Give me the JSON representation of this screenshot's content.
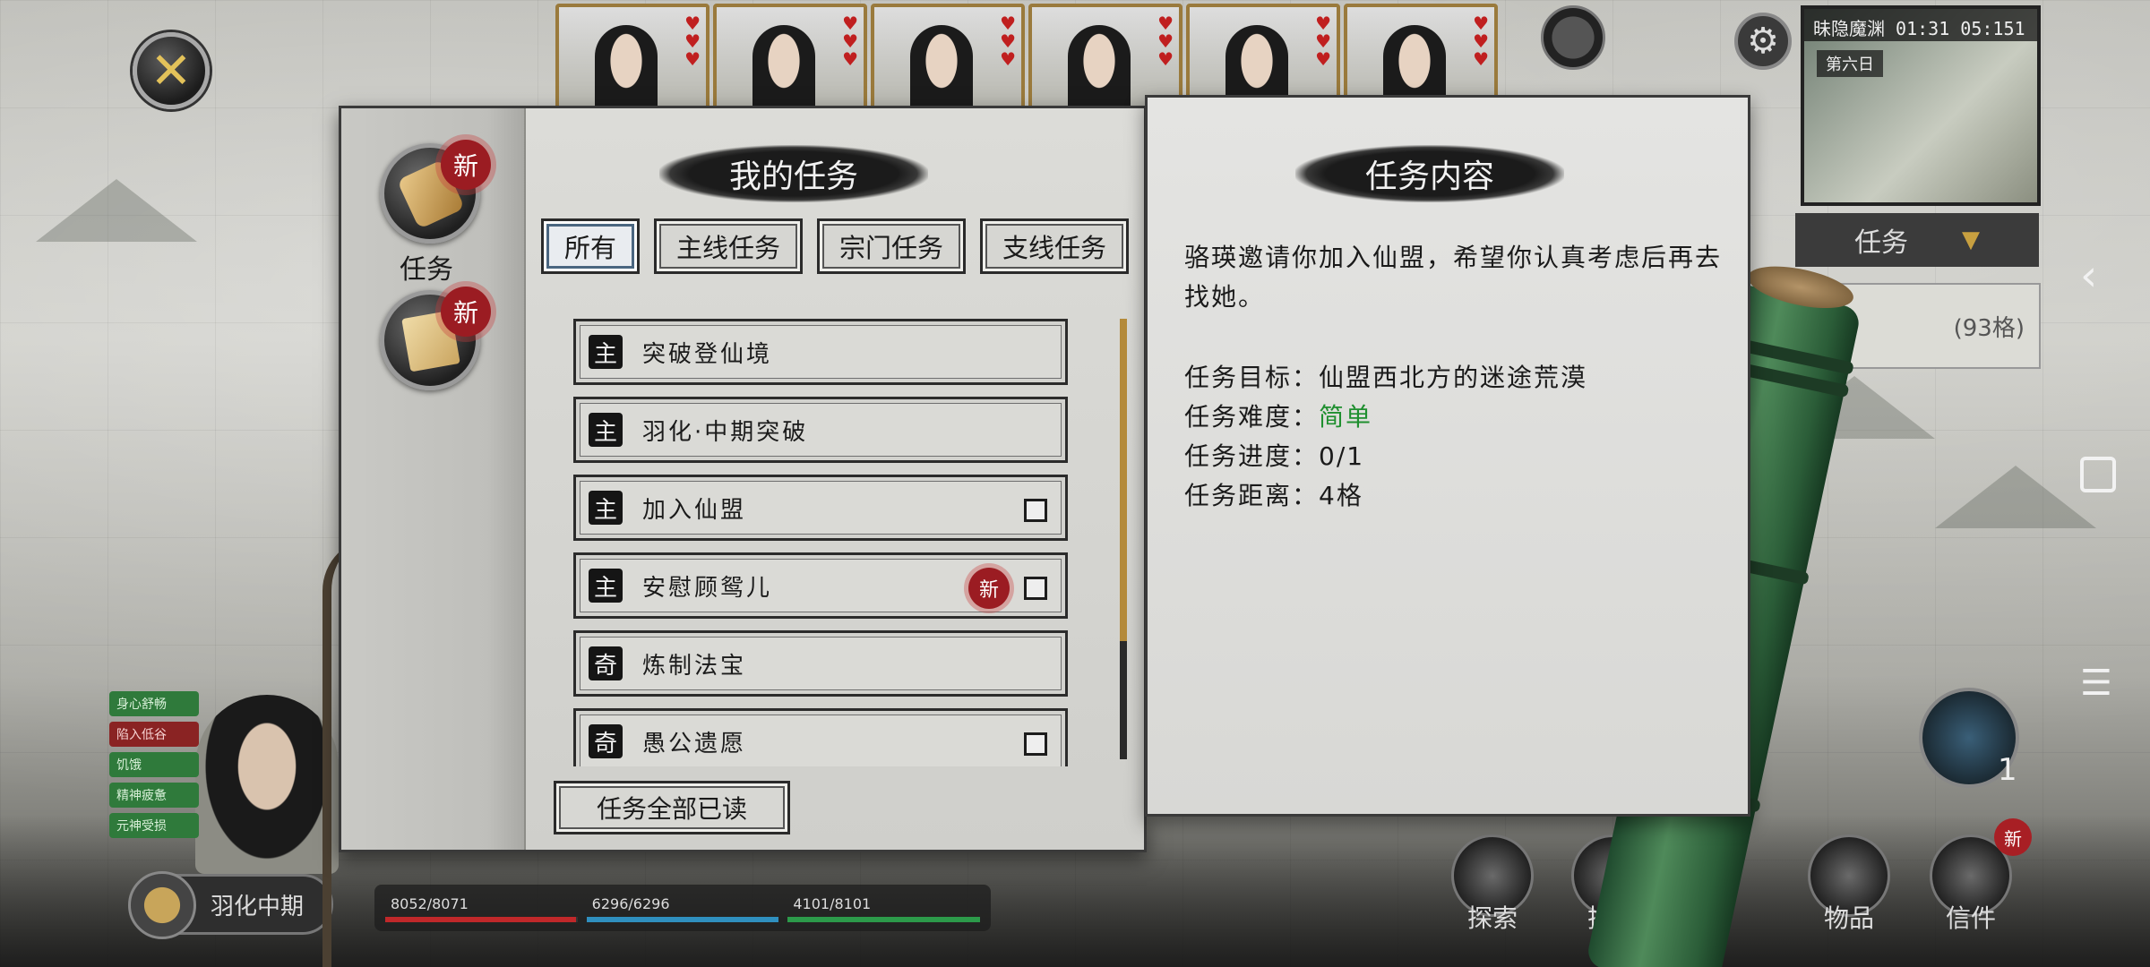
{
  "header": {
    "portraits": [
      {
        "name": "portrait-1",
        "hearts": 3
      },
      {
        "name": "portrait-2",
        "hearts": 3
      },
      {
        "name": "portrait-3",
        "hearts": 3
      },
      {
        "name": "portrait-4",
        "hearts": 3
      },
      {
        "name": "portrait-5",
        "hearts": 3
      },
      {
        "name": "portrait-6",
        "hearts": 3
      }
    ],
    "minimap": {
      "time": "昧隐魔渊 01:31 05:151",
      "day": "第六日"
    },
    "task_dropdown": "任务",
    "map_panel_text": "(93格)"
  },
  "sidebar": {
    "tabs": [
      {
        "label": "任务",
        "new_badge": "新"
      },
      {
        "label": "",
        "new_badge": "新"
      }
    ]
  },
  "left_page": {
    "title": "我的任务",
    "filters": [
      "所有",
      "主线任务",
      "宗门任务",
      "支线任务"
    ],
    "active_filter": "所有",
    "quests": [
      {
        "type": "主",
        "name": "突破登仙境",
        "checkbox": false,
        "is_new": false
      },
      {
        "type": "主",
        "name": "羽化·中期突破",
        "checkbox": false,
        "is_new": false
      },
      {
        "type": "主",
        "name": "加入仙盟",
        "checkbox": true,
        "is_new": false
      },
      {
        "type": "主",
        "name": "安慰顾鸳儿",
        "checkbox": true,
        "is_new": true,
        "new_label": "新"
      },
      {
        "type": "奇",
        "name": "炼制法宝",
        "checkbox": false,
        "is_new": false
      },
      {
        "type": "奇",
        "name": "愚公遗愿",
        "checkbox": true,
        "is_new": false
      }
    ],
    "mark_all_read": "任务全部已读"
  },
  "right_page": {
    "title": "任务内容",
    "description": "骆瑛邀请你加入仙盟，希望你认真考虑后再去找她。",
    "goal_label": "任务目标：",
    "goal_value": "仙盟西北方的迷途荒漠",
    "difficulty_label": "任务难度：",
    "difficulty_value": "简单",
    "progress_label": "任务进度：",
    "progress_value": "0/1",
    "distance_label": "任务距离：",
    "distance_value": "4格"
  },
  "status": {
    "tags": [
      "身心舒畅",
      "陷入低谷",
      "饥饿",
      "精神疲惫",
      "元神受损"
    ],
    "realm": "羽化中期",
    "hp": "8052/8071",
    "mp": "6296/6296",
    "sp": "4101/8101",
    "colors": {
      "hp": "#c0282a",
      "mp": "#2f8fbf",
      "sp": "#2c9a4a"
    }
  },
  "bottom_menu": {
    "items": [
      "探索",
      "技能",
      "物品",
      "信件"
    ],
    "letters_badge": "新",
    "yinyang_count": "1"
  },
  "colors": {
    "difficulty_easy": "#1f8f2f",
    "new_badge": "#9b1c22",
    "scroll_thumb": "#b48a3a"
  }
}
